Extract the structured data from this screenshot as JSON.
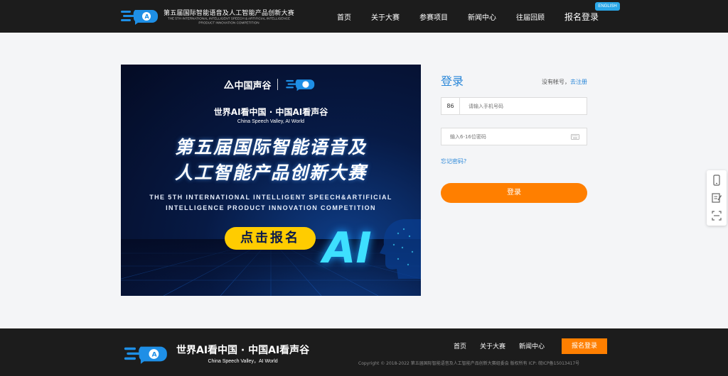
{
  "header": {
    "logo_cn": "第五届国际智能语音及人工智能产品创新大赛",
    "logo_en_1": "THE 5TH INTERNATIONAL INTELLIGENT SPEECH & ARTIFICIAL INTELLIGENCE",
    "logo_en_2": "PRODUCT INNOVATION COMPETITION",
    "nav": [
      "首页",
      "关于大赛",
      "参赛项目",
      "新闻中心",
      "往届回顾"
    ],
    "login_register": "报名登录",
    "english_badge": "ENGLISH"
  },
  "banner": {
    "brand_name": "中国声谷",
    "slogan_cn": "世界AI看中国 · 中国AI看声谷",
    "slogan_en": "China Speech Valley, AI World",
    "title_line1": "第五届国际智能语音及",
    "title_line2": "人工智能产品创新大赛",
    "en_line1": "THE 5TH INTERNATIONAL INTELLIGENT SPEECH&ARTIFICIAL",
    "en_line2": "INTELLIGENCE PRODUCT INNOVATION COMPETITION",
    "cta": "点击报名",
    "ai_text": "AI"
  },
  "login": {
    "title": "登录",
    "no_account": "没有帐号，",
    "register_link": "去注册",
    "country_code": "86",
    "phone_placeholder": "请输入手机号码",
    "password_placeholder": "输入6-16位密码",
    "forgot": "忘记密码?",
    "submit": "登录"
  },
  "side_toolbar": {
    "icons": [
      "mobile-icon",
      "edit-form-icon",
      "scan-icon"
    ]
  },
  "footer": {
    "slogan_cn": "世界AI看中国 · 中国AI看声谷",
    "slogan_en": "China Speech Valley，AI World",
    "nav": [
      "首页",
      "关于大赛",
      "新闻中心"
    ],
    "register_button": "报名登录",
    "copyright": "Copyright © 2018-2022 第五届国际智能语音及人工智能产品创新大赛组委会 版权所有 ICP: 皖ICP备15013417号"
  },
  "colors": {
    "header_bg": "#1c1c1c",
    "accent_blue": "#2a87d8",
    "accent_orange": "#ff7f00",
    "banner_bg": "#071a45",
    "cta_yellow": "#ffcc00"
  }
}
